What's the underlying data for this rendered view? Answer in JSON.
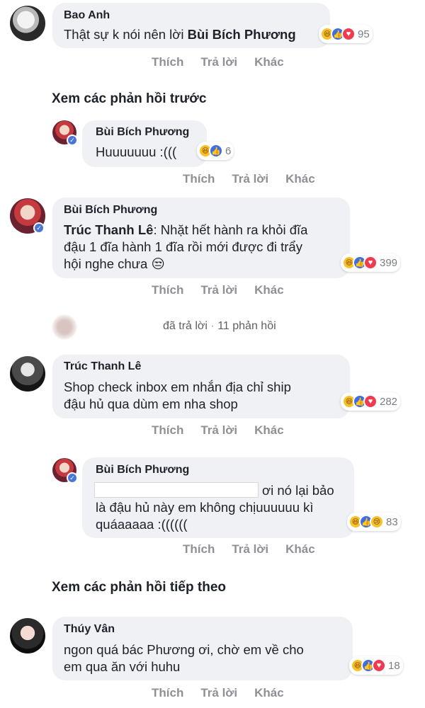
{
  "comments": [
    {
      "author": "Bao Anh",
      "text_plain": "Thật sự k nói nên lời ",
      "text_mention": "Bùi Bích Phương",
      "reaction_count": "95",
      "actions": [
        "Thích",
        "Trả lời",
        "Khác"
      ]
    }
  ],
  "see_previous": "Xem các phản hồi trước",
  "replies": [
    {
      "author": "Bùi Bích Phương",
      "text": "Huuuuuuu :(((",
      "reaction_count": "6",
      "actions": [
        "Thích",
        "Trả lời",
        "Khác"
      ]
    },
    {
      "author": "Bùi Bích Phương",
      "mention": "Trúc Thanh Lê",
      "text_line1": ": Nhặt hết hành ra khỏi đĩa",
      "text_line2": "đậu 1 đĩa hành 1 đĩa rồi mới được đi trẩy",
      "text_line3": "hội nghe chưa 😒",
      "reaction_count": "399",
      "actions": [
        "Thích",
        "Trả lời",
        "Khác"
      ]
    },
    {
      "summary": "đã trả lời",
      "summary_count": "11 phản hồi"
    },
    {
      "author": "Trúc Thanh Lê",
      "text_line1": "Shop check inbox em nhắn địa chỉ ship",
      "text_line2": "đậu hủ qua dùm em nha shop",
      "reaction_count": "282",
      "actions": [
        "Thích",
        "Trả lời",
        "Khác"
      ]
    },
    {
      "author": "Bùi Bích Phương",
      "text_line1": "ơi nó lại bảo",
      "text_line2": "là đậu hủ này em không chịuuuuuu kì",
      "text_line3": "quáaaaaa :((((((",
      "reaction_count": "83",
      "actions": [
        "Thích",
        "Trả lời",
        "Khác"
      ]
    }
  ],
  "see_next": "Xem các phản hồi tiếp theo",
  "last": {
    "author": "Thúy Vân",
    "text_line1": "ngon quá bác Phương ơi, chờ em về cho",
    "text_line2": "em qua ăn với huhu",
    "reaction_count": "18",
    "actions": [
      "Thích",
      "Trả lời",
      "Khác"
    ]
  },
  "colors": {
    "bubble": "#f0f1f4",
    "like": "#3d6fe3",
    "love": "#ef3b4f",
    "haha": "#f7c12a",
    "verified": "#4a77d6"
  }
}
